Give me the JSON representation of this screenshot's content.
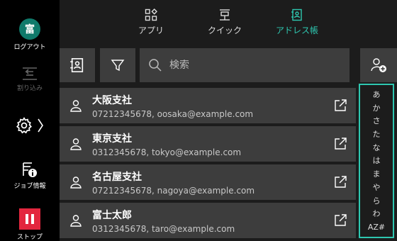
{
  "sidebar": {
    "logout": {
      "badge": "富",
      "label": "ログアウト"
    },
    "interrupt": {
      "label": "割り込み"
    },
    "job_info": {
      "label": "ジョブ情報"
    },
    "stop": {
      "label": "ストップ"
    }
  },
  "tabs": [
    {
      "label": "アプリ",
      "icon": "apps-icon",
      "active": false
    },
    {
      "label": "クイック",
      "icon": "quick-icon",
      "active": false
    },
    {
      "label": "アドレス帳",
      "icon": "address-book-icon",
      "active": true
    }
  ],
  "search": {
    "placeholder": "検索"
  },
  "contacts": [
    {
      "name": "大阪支社",
      "detail": "07212345678, oosaka@example.com"
    },
    {
      "name": "東京支社",
      "detail": "0312345678, tokyo@example.com"
    },
    {
      "name": "名古屋支社",
      "detail": "07212345678, nagoya@example.com"
    },
    {
      "name": "富士太郎",
      "detail": "0312345678, taro@example.com"
    }
  ],
  "index": [
    "あ",
    "か",
    "さ",
    "た",
    "な",
    "は",
    "ま",
    "や",
    "ら",
    "わ",
    "AZ#"
  ],
  "colors": {
    "accent": "#2ec7b0",
    "logout": "#0f7a6b",
    "stop": "#e3263e"
  }
}
